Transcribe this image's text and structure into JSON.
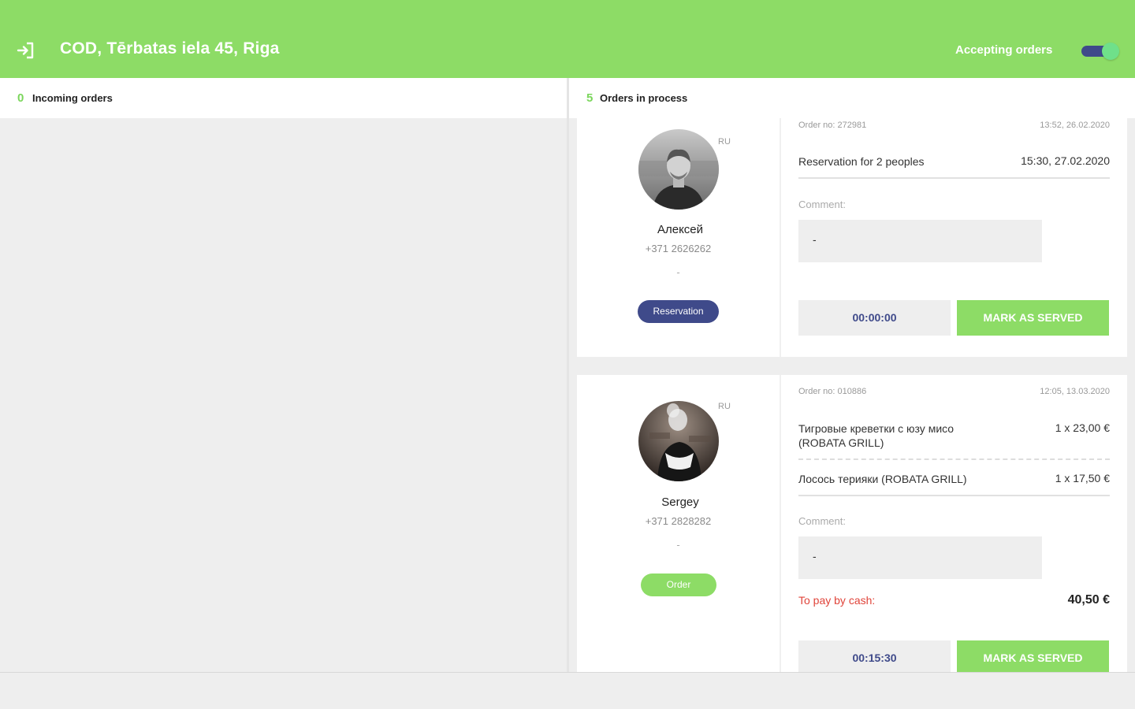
{
  "header": {
    "venue_title": "COD, Tērbatas iela 45, Riga",
    "accepting_label": "Accepting orders",
    "accepting_enabled": true,
    "exit_icon": "exit-icon"
  },
  "incoming": {
    "count": "0",
    "title": "Incoming orders"
  },
  "in_process": {
    "count": "5",
    "title": "Orders in process"
  },
  "orders": [
    {
      "lang": "RU",
      "customer_name": "Алексей",
      "phone": "+371 2626262",
      "extra": "-",
      "type_label": "Reservation",
      "order_no": "Order no: 272981",
      "order_time": "13:52, 26.02.2020",
      "items": [
        {
          "name": "Reservation for 2 peoples",
          "value": "15:30, 27.02.2020"
        }
      ],
      "comment_label": "Comment:",
      "comment": "-",
      "timer": "00:00:00",
      "served_label": "MARK AS SERVED"
    },
    {
      "lang": "RU",
      "customer_name": "Sergey",
      "phone": "+371 2828282",
      "extra": "-",
      "type_label": "Order",
      "order_no": "Order no: 010886",
      "order_time": "12:05, 13.03.2020",
      "items": [
        {
          "name": "Тигровые креветки с юзу мисо (ROBATA GRILL)",
          "value": "1 x 23,00 €"
        },
        {
          "name": "Лосось терияки (ROBATA GRILL)",
          "value": "1 x 17,50 €"
        }
      ],
      "comment_label": "Comment:",
      "comment": "-",
      "cash_label": "To pay by cash:",
      "total": "40,50 €",
      "timer": "00:15:30",
      "served_label": "MARK AS SERVED"
    }
  ],
  "colors": {
    "brand_green": "#8ddc66",
    "accent_navy": "#3f4a8a",
    "cash_red": "#e0443a"
  }
}
